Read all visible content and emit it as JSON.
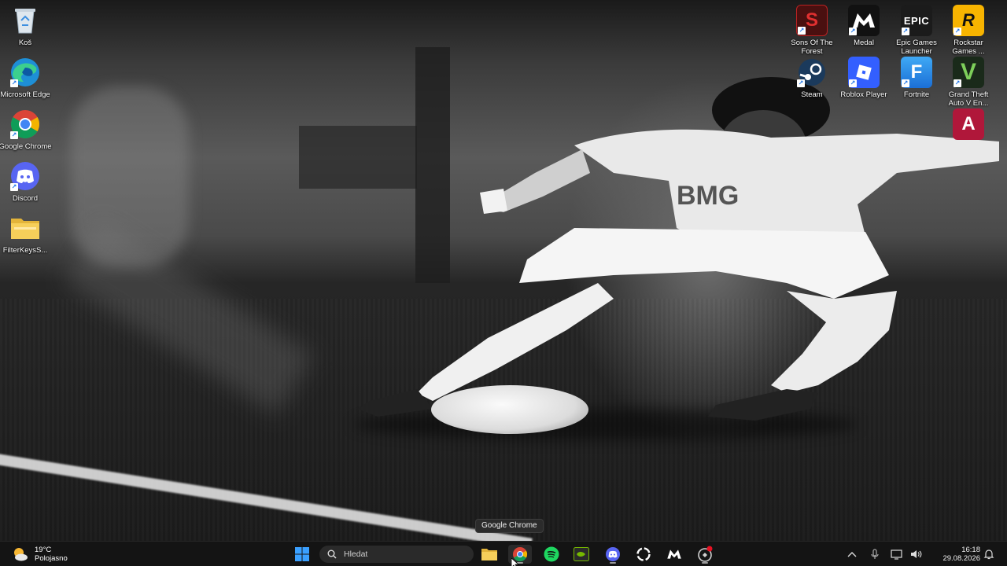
{
  "desktop": {
    "icons_left": [
      {
        "label": "Koš",
        "icon": "recycle-bin-icon"
      },
      {
        "label": "Microsoft Edge",
        "icon": "edge-icon"
      },
      {
        "label": "Google Chrome",
        "icon": "chrome-icon"
      },
      {
        "label": "Discord",
        "icon": "discord-icon"
      },
      {
        "label": "FilterKeysS...",
        "icon": "folder-icon"
      }
    ],
    "icons_right": [
      {
        "label": "Sons Of The Forest",
        "icon": "sons-of-the-forest-icon",
        "glyph": "S"
      },
      {
        "label": "Medal",
        "icon": "medal-icon",
        "glyph": "M"
      },
      {
        "label": "Epic Games Launcher",
        "icon": "epic-games-icon",
        "glyph": "EPIC"
      },
      {
        "label": "Rockstar Games ...",
        "icon": "rockstar-icon",
        "glyph": "R"
      },
      {
        "label": "Steam",
        "icon": "steam-icon",
        "glyph": ""
      },
      {
        "label": "Roblox Player",
        "icon": "roblox-icon",
        "glyph": ""
      },
      {
        "label": "Fortnite",
        "icon": "fortnite-icon",
        "glyph": "F"
      },
      {
        "label": "Grand Theft Auto V En...",
        "icon": "gta-v-icon",
        "glyph": "V"
      },
      {
        "label": "",
        "icon": "app-a-icon",
        "glyph": "A"
      }
    ]
  },
  "tooltip": {
    "text": "Google Chrome"
  },
  "taskbar": {
    "weather": {
      "temp": "19°C",
      "condition": "Polojasno"
    },
    "search": {
      "placeholder": "Hledat"
    },
    "apps": [
      {
        "name": "start",
        "icon": "windows-start-icon"
      },
      {
        "name": "file-explorer",
        "icon": "folder-icon"
      },
      {
        "name": "chrome",
        "icon": "chrome-icon"
      },
      {
        "name": "spotify",
        "icon": "spotify-icon"
      },
      {
        "name": "nvidia",
        "icon": "nvidia-icon"
      },
      {
        "name": "discord",
        "icon": "discord-icon"
      },
      {
        "name": "app-circle",
        "icon": "circle-app-icon"
      },
      {
        "name": "medal",
        "icon": "medal-icon"
      },
      {
        "name": "app-notify",
        "icon": "notification-app-icon"
      }
    ],
    "tray": {
      "chevron": "^",
      "time": "16:18",
      "date": "29.08.2026"
    }
  },
  "colors": {
    "taskbar_bg": "#141414",
    "windows_blue": "#3aa0ff",
    "spotify_green": "#1ed760",
    "discord_blurple": "#5865f2"
  }
}
